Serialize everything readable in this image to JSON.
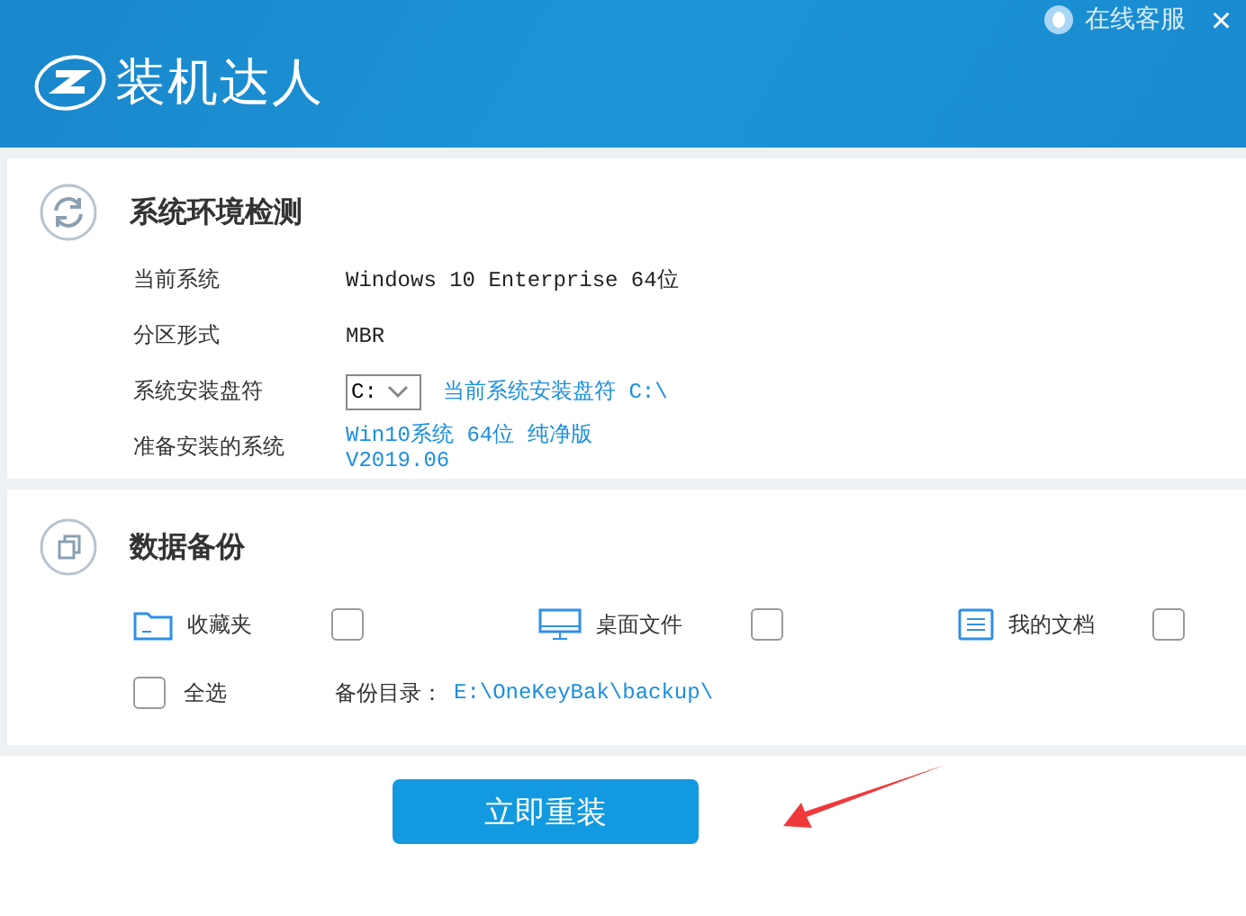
{
  "header": {
    "logo_text": "装机达人",
    "support_link": "在线客服",
    "close": "×"
  },
  "env_check": {
    "title": "系统环境检测",
    "rows": [
      {
        "kind": "text",
        "label": "当前系统",
        "value": "Windows 10 Enterprise 64位"
      },
      {
        "kind": "text",
        "label": "分区形式",
        "value": "MBR"
      },
      {
        "kind": "select",
        "label": "系统安装盘符",
        "value": "C:",
        "note": "当前系统安装盘符 C:\\"
      },
      {
        "kind": "link",
        "label": "准备安装的系统",
        "value": "Win10系统 64位 纯净版",
        "value2": "V2019.06"
      }
    ]
  },
  "backup": {
    "title": "数据备份",
    "items": [
      {
        "kind": "folder",
        "label": "收藏夹",
        "checked": false
      },
      {
        "kind": "desktop",
        "label": "桌面文件",
        "checked": false
      },
      {
        "kind": "document",
        "label": "我的文档",
        "checked": false
      }
    ],
    "select_all": {
      "label": "全选",
      "checked": false
    },
    "dir_label": "备份目录：",
    "dir_path": "E:\\OneKeyBak\\backup\\"
  },
  "primary_button": "立即重装"
}
